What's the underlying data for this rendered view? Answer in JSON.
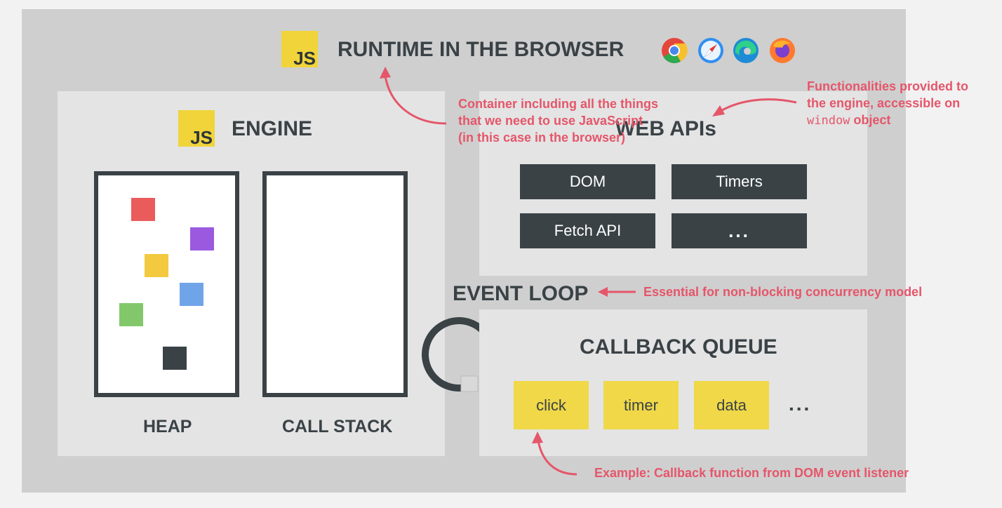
{
  "title": "RUNTIME IN THE BROWSER",
  "js_logo": "JS",
  "engine": {
    "title": "ENGINE",
    "heap_label": "HEAP",
    "callstack_label": "CALL STACK"
  },
  "web_apis": {
    "title": "WEB APIs",
    "items": [
      "DOM",
      "Timers",
      "Fetch API",
      "..."
    ]
  },
  "event_loop": {
    "title": "EVENT LOOP"
  },
  "callback_queue": {
    "title": "CALLBACK QUEUE",
    "items": [
      "click",
      "timer",
      "data"
    ],
    "more": "..."
  },
  "annotations": {
    "container": [
      "Container including all the things",
      "that we need to use JavaScript",
      "(in this case in the browser)"
    ],
    "web_apis": [
      "Functionalities provided to",
      "the engine, accessible on"
    ],
    "web_apis_code": "window",
    "web_apis_tail": " object",
    "event_loop": "Essential for non-blocking concurrency model",
    "callback": "Example: Callback function from DOM event listener"
  },
  "browsers": [
    "chrome-icon",
    "safari-icon",
    "edge-icon",
    "firefox-icon"
  ],
  "colors": {
    "accent_red": "#e5566a",
    "dark": "#3a4246",
    "js_yellow": "#f0d43a",
    "heap_squares": [
      "#ea5c5c",
      "#9b59e0",
      "#f3c93f",
      "#6fa4e8",
      "#82c86a",
      "#3a4246"
    ]
  }
}
